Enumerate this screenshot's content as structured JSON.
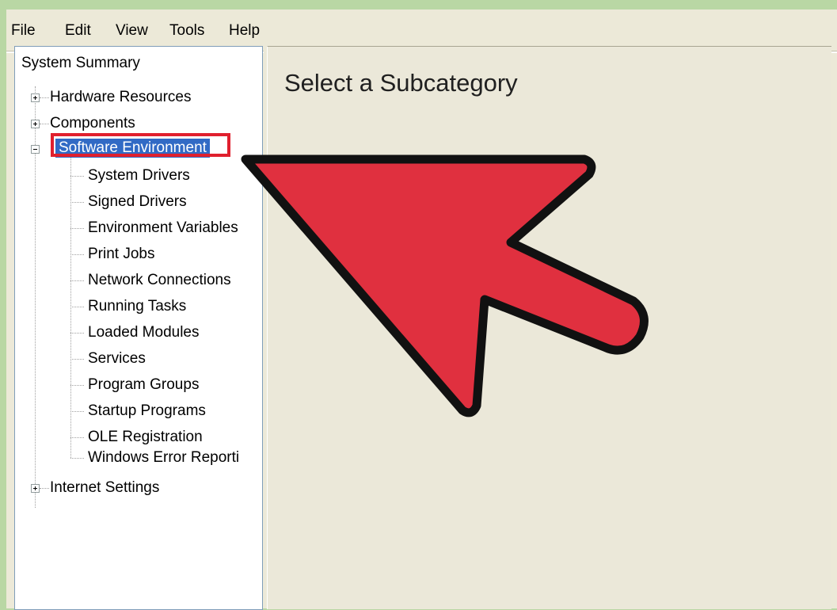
{
  "menu": {
    "file": "File",
    "edit": "Edit",
    "view": "View",
    "tools": "Tools",
    "help": "Help"
  },
  "tree": {
    "root": "System Summary",
    "nodes": {
      "hardware": "Hardware Resources",
      "components": "Components",
      "software": "Software Environment",
      "internet": "Internet Settings"
    },
    "software_children": [
      "System Drivers",
      "Signed Drivers",
      "Environment Variables",
      "Print Jobs",
      "Network Connections",
      "Running Tasks",
      "Loaded Modules",
      "Services",
      "Program Groups",
      "Startup Programs",
      "OLE Registration",
      "Windows Error Reporti"
    ],
    "selected": "Software Environment"
  },
  "detail": {
    "title": "Select a Subcategory"
  },
  "colors": {
    "annotation_arrow": "#e0303f",
    "annotation_outline": "#111111",
    "highlight_box": "#e0202e",
    "selection": "#316ac5",
    "window_bg": "#ece9d8",
    "frame_bg": "#b9d7a4"
  }
}
